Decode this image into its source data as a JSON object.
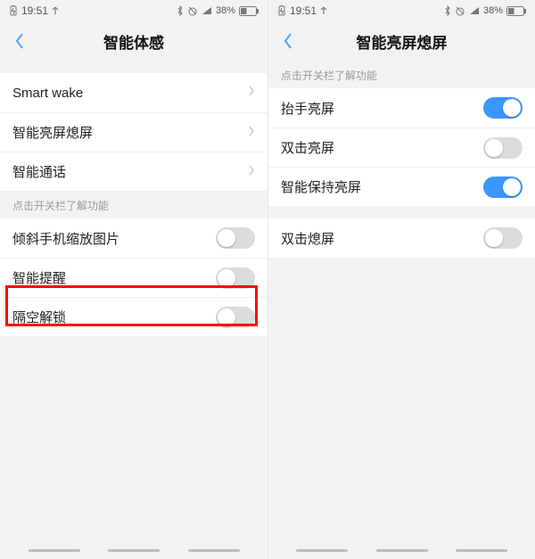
{
  "status": {
    "time": "19:51",
    "battery_pct": "38%"
  },
  "left": {
    "title": "智能体感",
    "nav": [
      {
        "label": "Smart wake"
      },
      {
        "label": "智能亮屏熄屏"
      },
      {
        "label": "智能通话"
      }
    ],
    "section_header": "点击开关栏了解功能",
    "toggles": [
      {
        "label": "倾斜手机缩放图片",
        "on": false
      },
      {
        "label": "智能提醒",
        "on": false
      },
      {
        "label": "隔空解锁",
        "on": false,
        "highlighted": true
      }
    ]
  },
  "right": {
    "title": "智能亮屏熄屏",
    "section_header": "点击开关栏了解功能",
    "group1": [
      {
        "label": "抬手亮屏",
        "on": true
      },
      {
        "label": "双击亮屏",
        "on": false
      },
      {
        "label": "智能保持亮屏",
        "on": true
      }
    ],
    "group2": [
      {
        "label": "双击熄屏",
        "on": false
      }
    ]
  }
}
